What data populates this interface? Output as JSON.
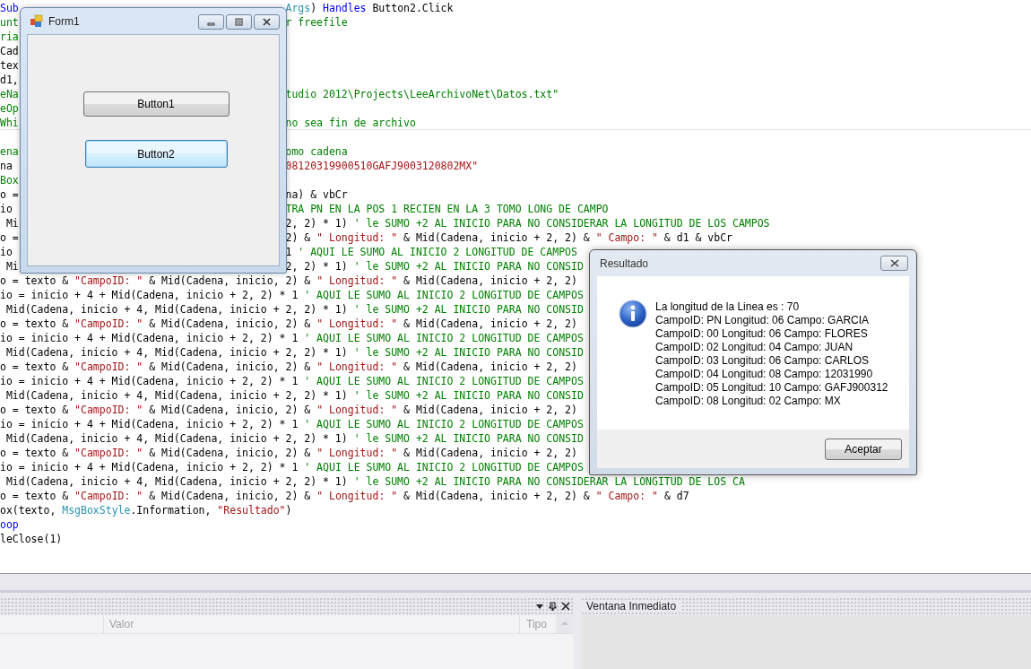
{
  "editor": {
    "lines": [
      {
        "left": [
          {
            "kind": "keyword",
            "text": "Sub"
          }
        ],
        "right": [
          {
            "kind": "type",
            "text": "Args"
          },
          {
            "kind": "plain",
            "text": ") "
          },
          {
            "kind": "keyword",
            "text": "Handles"
          },
          {
            "kind": "plain",
            "text": " Button2.Click"
          }
        ]
      },
      {
        "left": [
          {
            "kind": "comment",
            "text": "unt"
          }
        ],
        "right": [
          {
            "kind": "comment",
            "text": "r freefile"
          }
        ]
      },
      {
        "left": [
          {
            "kind": "comment",
            "text": "ria"
          }
        ]
      },
      {
        "left": [
          {
            "kind": "plain",
            "text": "Cad"
          }
        ]
      },
      {
        "left": [
          {
            "kind": "plain",
            "text": "tex"
          }
        ]
      },
      {
        "left": [
          {
            "kind": "plain",
            "text": "d1,"
          }
        ]
      },
      {
        "left": [
          {
            "kind": "comment",
            "text": "eNa"
          }
        ],
        "right": [
          {
            "kind": "comment",
            "text": "tudio 2012\\Projects\\LeeArchivoNet\\Datos.txt\""
          }
        ]
      },
      {
        "left": [
          {
            "kind": "comment",
            "text": "eOp"
          }
        ]
      },
      {
        "left": [
          {
            "kind": "comment",
            "text": "Whi"
          }
        ],
        "right": [
          {
            "kind": "comment",
            "text": "no sea fin de archivo"
          }
        ],
        "rule_below": true
      },
      {
        "left": [
          {
            "kind": "comment",
            "text": "ena"
          }
        ],
        "right": [
          {
            "kind": "comment",
            "text": "omo cadena"
          }
        ]
      },
      {
        "left": [
          {
            "kind": "plain",
            "text": "na"
          }
        ],
        "right": [
          {
            "kind": "string",
            "text": "08120319900510GAFJ9003120802MX\""
          }
        ]
      },
      {
        "left": [
          {
            "kind": "comment",
            "text": "Box"
          }
        ]
      },
      {
        "left": [
          {
            "kind": "plain",
            "text": "o ="
          }
        ],
        "right": [
          {
            "kind": "plain",
            "text": "na) & vbCr"
          }
        ]
      },
      {
        "left": [
          {
            "kind": "plain",
            "text": "io"
          }
        ],
        "right": [
          {
            "kind": "comment",
            "text": "TRA PN EN LA POS 1 RECIEN EN LA 3 TOMO LONG DE CAMPO"
          }
        ]
      },
      {
        "left": [
          {
            "kind": "plain",
            "text": " Mi"
          }
        ],
        "right": [
          {
            "kind": "plain",
            "text": "2, 2) * 1) "
          },
          {
            "kind": "comment",
            "text": "' le SUMO +2 AL INICIO PARA NO CONSIDERAR LA LONGITUD DE LOS CAMPOS"
          }
        ]
      },
      {
        "left": [
          {
            "kind": "plain",
            "text": "o ="
          }
        ],
        "right": [
          {
            "kind": "plain",
            "text": "2) & "
          },
          {
            "kind": "string",
            "text": "\" Longitud: \""
          },
          {
            "kind": "plain",
            "text": " & Mid(Cadena, inicio + 2, 2) & "
          },
          {
            "kind": "string",
            "text": "\" Campo: \""
          },
          {
            "kind": "plain",
            "text": " & d1 & vbCr"
          }
        ]
      },
      {
        "left": [
          {
            "kind": "plain",
            "text": "io"
          }
        ],
        "right": [
          {
            "kind": "plain",
            "text": "1 "
          },
          {
            "kind": "comment",
            "text": "' AQUI LE SUMO AL INICIO 2 LONGITUD DE CAMPOS"
          }
        ]
      },
      {
        "left": [
          {
            "kind": "plain",
            "text": " Mi"
          }
        ],
        "right": [
          {
            "kind": "plain",
            "text": "2, 2) * 1) "
          },
          {
            "kind": "comment",
            "text": "' le SUMO +2 AL INICIO PARA NO CONSID"
          }
        ]
      },
      {
        "left": [
          {
            "kind": "plain",
            "text": "o = texto & "
          },
          {
            "kind": "string",
            "text": "\"CampoID: \""
          },
          {
            "kind": "plain",
            "text": " & Mid(Cadena, inicio, 2) & "
          },
          {
            "kind": "string",
            "text": "\" Longitud: \""
          },
          {
            "kind": "plain",
            "text": " & Mid(Cadena, inicio + 2, 2)"
          }
        ]
      },
      {
        "left": [
          {
            "kind": "plain",
            "text": "io = inicio + 4 + Mid(Cadena, inicio + 2, 2) * 1 "
          },
          {
            "kind": "comment",
            "text": "' AQUI LE SUMO AL INICIO 2 LONGITUD DE CAMPOS"
          }
        ]
      },
      {
        "left": [
          {
            "kind": "plain",
            "text": " Mid(Cadena, inicio + 4, Mid(Cadena, inicio + 2, 2) * 1) "
          },
          {
            "kind": "comment",
            "text": "' le SUMO +2 AL INICIO PARA NO CONSID"
          }
        ]
      },
      {
        "left": [
          {
            "kind": "plain",
            "text": "o = texto & "
          },
          {
            "kind": "string",
            "text": "\"CampoID: \""
          },
          {
            "kind": "plain",
            "text": " & Mid(Cadena, inicio, 2) & "
          },
          {
            "kind": "string",
            "text": "\" Longitud: \""
          },
          {
            "kind": "plain",
            "text": " & Mid(Cadena, inicio + 2, 2)"
          }
        ]
      },
      {
        "left": [
          {
            "kind": "plain",
            "text": "io = inicio + 4 + Mid(Cadena, inicio + 2, 2) * 1 "
          },
          {
            "kind": "comment",
            "text": "' AQUI LE SUMO AL INICIO 2 LONGITUD DE CAMPOS"
          }
        ]
      },
      {
        "left": [
          {
            "kind": "plain",
            "text": " Mid(Cadena, inicio + 4, Mid(Cadena, inicio + 2, 2) * 1) "
          },
          {
            "kind": "comment",
            "text": "' le SUMO +2 AL INICIO PARA NO CONSID"
          }
        ]
      },
      {
        "left": [
          {
            "kind": "plain",
            "text": "o = texto & "
          },
          {
            "kind": "string",
            "text": "\"CampoID: \""
          },
          {
            "kind": "plain",
            "text": " & Mid(Cadena, inicio, 2) & "
          },
          {
            "kind": "string",
            "text": "\" Longitud: \""
          },
          {
            "kind": "plain",
            "text": " & Mid(Cadena, inicio + 2, 2)"
          }
        ]
      },
      {
        "left": [
          {
            "kind": "plain",
            "text": "io = inicio + 4 + Mid(Cadena, inicio + 2, 2) * 1 "
          },
          {
            "kind": "comment",
            "text": "' AQUI LE SUMO AL INICIO 2 LONGITUD DE CAMPOS"
          }
        ]
      },
      {
        "left": [
          {
            "kind": "plain",
            "text": " Mid(Cadena, inicio + 4, Mid(Cadena, inicio + 2, 2) * 1) "
          },
          {
            "kind": "comment",
            "text": "' le SUMO +2 AL INICIO PARA NO CONSID"
          }
        ]
      },
      {
        "left": [
          {
            "kind": "plain",
            "text": "o = texto & "
          },
          {
            "kind": "string",
            "text": "\"CampoID: \""
          },
          {
            "kind": "plain",
            "text": " & Mid(Cadena, inicio, 2) & "
          },
          {
            "kind": "string",
            "text": "\" Longitud: \""
          },
          {
            "kind": "plain",
            "text": " & Mid(Cadena, inicio + 2, 2)"
          }
        ]
      },
      {
        "left": [
          {
            "kind": "plain",
            "text": "io = inicio + 4 + Mid(Cadena, inicio + 2, 2) * 1 "
          },
          {
            "kind": "comment",
            "text": "' AQUI LE SUMO AL INICIO 2 LONGITUD DE CAMPOS"
          }
        ]
      },
      {
        "left": [
          {
            "kind": "plain",
            "text": " Mid(Cadena, inicio + 4, Mid(Cadena, inicio + 2, 2) * 1) "
          },
          {
            "kind": "comment",
            "text": "' le SUMO +2 AL INICIO PARA NO CONSID"
          }
        ]
      },
      {
        "left": [
          {
            "kind": "plain",
            "text": "o = texto & "
          },
          {
            "kind": "string",
            "text": "\"CampoID: \""
          },
          {
            "kind": "plain",
            "text": " & Mid(Cadena, inicio, 2) & "
          },
          {
            "kind": "string",
            "text": "\" Longitud: \""
          },
          {
            "kind": "plain",
            "text": " & Mid(Cadena, inicio + 2, 2)"
          }
        ]
      },
      {
        "left": [
          {
            "kind": "plain",
            "text": "io = inicio + 4 + Mid(Cadena, inicio + 2, 2) * 1 "
          },
          {
            "kind": "comment",
            "text": "' AQUI LE SUMO AL INICIO 2 LONGITUD DE CAMPOS"
          }
        ]
      },
      {
        "left": [
          {
            "kind": "plain",
            "text": " Mid(Cadena, inicio + 4, Mid(Cadena, inicio + 2, 2) * 1) "
          },
          {
            "kind": "comment",
            "text": "' le SUMO +2 AL INICIO PARA NO CONSIDERAR LA LONGITUD DE LOS CA"
          }
        ]
      },
      {
        "left": [
          {
            "kind": "plain",
            "text": "o = texto & "
          },
          {
            "kind": "string",
            "text": "\"CampoID: \""
          },
          {
            "kind": "plain",
            "text": " & Mid(Cadena, inicio, 2) & "
          },
          {
            "kind": "string",
            "text": "\" Longitud: \""
          },
          {
            "kind": "plain",
            "text": " & Mid(Cadena, inicio + 2, 2) & "
          },
          {
            "kind": "string",
            "text": "\" Campo: \""
          },
          {
            "kind": "plain",
            "text": " & d7"
          }
        ]
      },
      {
        "left": [
          {
            "kind": "plain",
            "text": "ox(texto, "
          },
          {
            "kind": "type",
            "text": "MsgBoxStyle"
          },
          {
            "kind": "plain",
            "text": ".Information, "
          },
          {
            "kind": "string",
            "text": "\"Resultado\""
          },
          {
            "kind": "plain",
            "text": ")"
          }
        ]
      },
      {
        "left": [
          {
            "kind": "keyword",
            "text": "oop"
          }
        ]
      },
      {
        "left": [
          {
            "kind": "plain",
            "text": "leClose(1)"
          }
        ]
      }
    ]
  },
  "form_window": {
    "title": "Form1",
    "buttons": [
      {
        "label": "Button1",
        "focused": false
      },
      {
        "label": "Button2",
        "focused": true
      }
    ]
  },
  "message_box": {
    "title": "Resultado",
    "lines": [
      "La longitud de la Linea es : 70",
      "CampoID: PN Longitud: 06 Campo: GARCIA",
      "CampoID: 00 Longitud: 06 Campo: FLORES",
      "CampoID: 02 Longitud: 04 Campo: JUAN",
      "CampoID: 03 Longitud: 06 Campo: CARLOS",
      "CampoID: 04 Longitud: 08 Campo: 12031990",
      "CampoID: 05 Longitud: 10 Campo: GAFJ900312",
      "CampoID: 08 Longitud: 02 Campo: MX"
    ],
    "button": "Aceptar"
  },
  "bottom_panels": {
    "left_panel": {
      "columns": [
        "Valor",
        "Tipo"
      ]
    },
    "right_panel": {
      "title": "Ventana Inmediato"
    }
  }
}
